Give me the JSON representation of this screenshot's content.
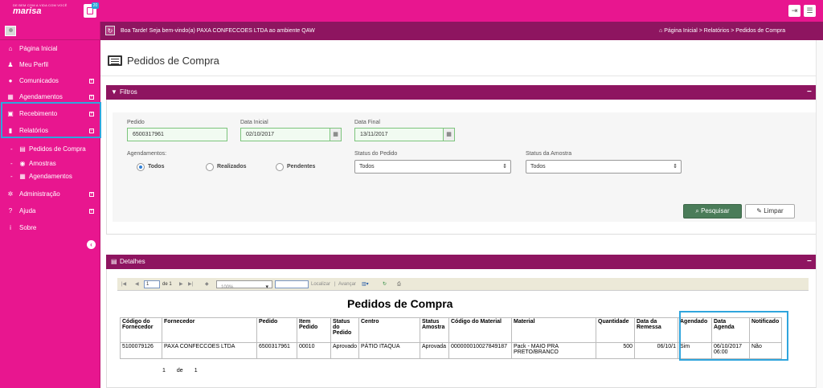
{
  "brand": {
    "tagline": "DE BEM COM A VIDA COM VOCÊ",
    "name": "marisa",
    "notif_count": "20"
  },
  "topbar": {
    "logout_icon": "logout-icon",
    "menu_icon": "hamburger-icon"
  },
  "sidebar": {
    "items": [
      {
        "label": "Página Inicial",
        "icon": "home-icon"
      },
      {
        "label": "Meu Perfil",
        "icon": "user-icon"
      },
      {
        "label": "Comunicados",
        "icon": "speech-bubble-icon",
        "expand": "⊞"
      },
      {
        "label": "Agendamentos",
        "icon": "calendar-icon",
        "expand": "⊞"
      },
      {
        "label": "Recebimento",
        "icon": "truck-icon",
        "expand": "⊞"
      },
      {
        "label": "Relatórios",
        "icon": "bar-chart-icon",
        "expand": "⊟"
      },
      {
        "label": "Administração",
        "icon": "gear-icon",
        "expand": "⊞"
      },
      {
        "label": "Ajuda",
        "icon": "help-icon",
        "expand": "⊞"
      },
      {
        "label": "Sobre",
        "icon": "info-icon"
      }
    ],
    "subitems": [
      {
        "label": "Pedidos de Compra",
        "icon": "list-icon"
      },
      {
        "label": "Amostras",
        "icon": "eye-icon"
      },
      {
        "label": "Agendamentos",
        "icon": "calendar-icon"
      }
    ]
  },
  "header": {
    "greeting": "Boa Tarde! Seja bem-vindo(a) PAXA CONFECCOES LTDA ao ambiente QAW",
    "breadcrumb": "Página Inicial > Relatórios > Pedidos de Compra"
  },
  "page": {
    "title": "Pedidos de Compra"
  },
  "filters": {
    "panel_title": "Filtros",
    "pedido_label": "Pedido",
    "pedido_value": "6500317961",
    "data_inicial_label": "Data Inicial",
    "data_inicial_value": "02/10/2017",
    "data_final_label": "Data Final",
    "data_final_value": "13/11/2017",
    "agendamentos_label": "Agendamentos:",
    "radio_todos": "Todos",
    "radio_realizados": "Realizados",
    "radio_pendentes": "Pendentes",
    "status_pedido_label": "Status do Pedido",
    "status_pedido_value": "Todos",
    "status_amostra_label": "Status da Amostra",
    "status_amostra_value": "Todos",
    "search_button": "Pesquisar",
    "clear_button": "Limpar"
  },
  "details": {
    "panel_title": "Detalhes",
    "toolbar": {
      "page_current": "1",
      "page_of": "de 1",
      "zoom": "100%",
      "find_label": "Localizar",
      "next_label": "Avançar"
    },
    "report_title": "Pedidos de Compra",
    "columns": [
      "Código do Fornecedor",
      "Fornecedor",
      "Pedido",
      "Item Pedido",
      "Status do Pedido",
      "Centro",
      "Status Amostra",
      "Código do Material",
      "Material",
      "Quantidade",
      "Data da Remessa",
      "Agendado",
      "Data Agenda",
      "Notificado"
    ],
    "rows": [
      [
        "5100079126",
        "PAXA CONFECCOES LTDA",
        "6500317961",
        "00010",
        "Aprovado",
        "PÁTIO ITAQUA",
        "Aprovada",
        "000000010027849187",
        "Pack - MAIO PRA PRETO/BRANCO",
        "500",
        "06/10/1",
        "Sim",
        "06/10/2017 06:00",
        "Não"
      ]
    ],
    "pager": {
      "current": "1",
      "of": "de",
      "total": "1"
    }
  }
}
